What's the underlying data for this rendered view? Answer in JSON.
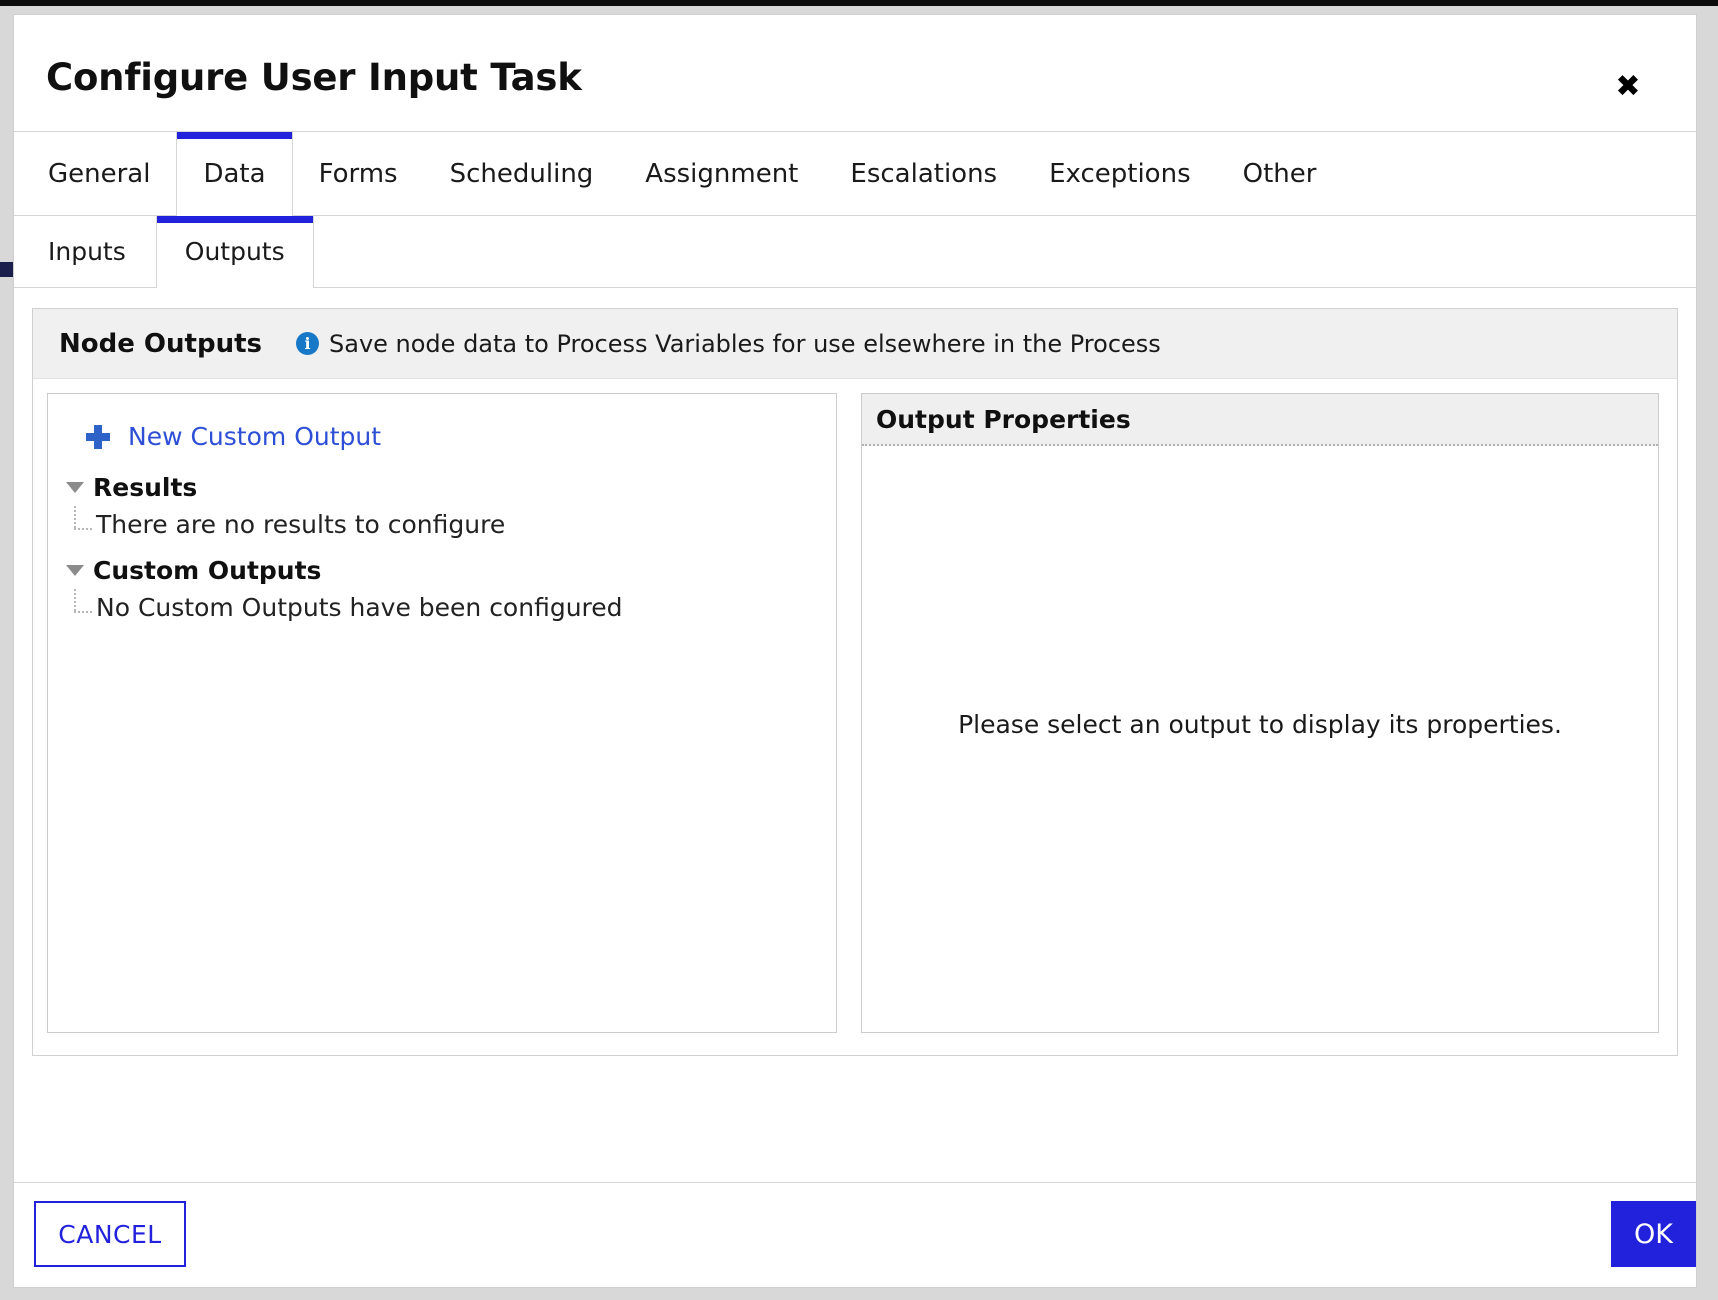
{
  "dialog": {
    "title": "Configure User Input Task",
    "close_label": "✖"
  },
  "tabs": [
    {
      "label": "General",
      "active": false
    },
    {
      "label": "Data",
      "active": true
    },
    {
      "label": "Forms",
      "active": false
    },
    {
      "label": "Scheduling",
      "active": false
    },
    {
      "label": "Assignment",
      "active": false
    },
    {
      "label": "Escalations",
      "active": false
    },
    {
      "label": "Exceptions",
      "active": false
    },
    {
      "label": "Other",
      "active": false
    }
  ],
  "subtabs": [
    {
      "label": "Inputs",
      "active": false
    },
    {
      "label": "Outputs",
      "active": true
    }
  ],
  "node_outputs": {
    "title": "Node Outputs",
    "hint": "Save node data to Process Variables for use elsewhere in the Process",
    "info_icon_glyph": "i",
    "info_icon_color": "#1878c8"
  },
  "tree": {
    "new_output_label": "New Custom Output",
    "groups": [
      {
        "label": "Results",
        "empty_message": "There are no results to configure"
      },
      {
        "label": "Custom Outputs",
        "empty_message": "No Custom Outputs have been configured"
      }
    ]
  },
  "properties": {
    "title": "Output Properties",
    "empty_message": "Please select an output to display its properties."
  },
  "footer": {
    "cancel_label": "CANCEL",
    "ok_label": "OK"
  },
  "colors": {
    "accent": "#2222dd",
    "link": "#2d4fd6",
    "panel_header_bg": "#f0f0f0",
    "page_bg": "#d8d8d8"
  }
}
